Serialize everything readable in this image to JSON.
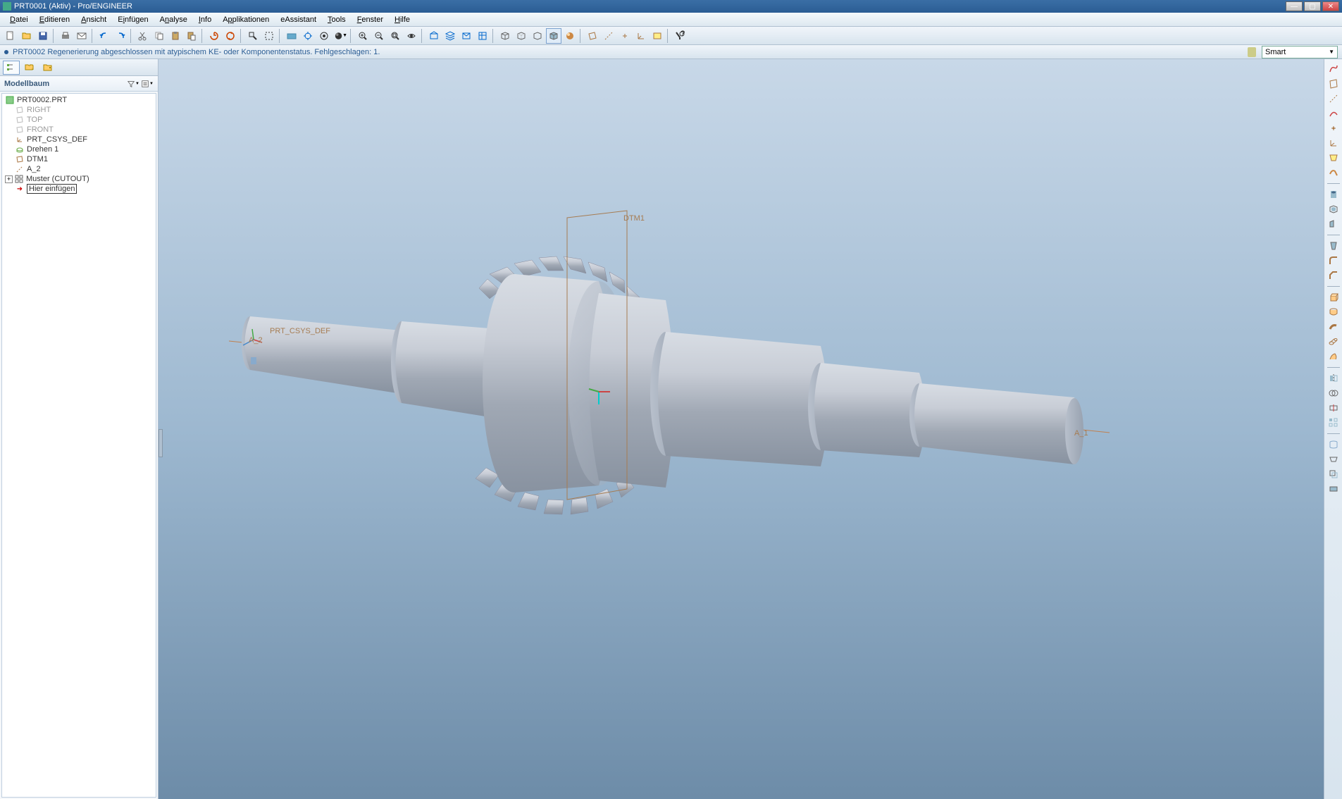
{
  "window": {
    "title": "PRT0001 (Aktiv) - Pro/ENGINEER"
  },
  "menubar": {
    "items": [
      "Datei",
      "Editieren",
      "Ansicht",
      "Einfügen",
      "Analyse",
      "Info",
      "Applikationen",
      "eAssistant",
      "Tools",
      "Fenster",
      "Hilfe"
    ]
  },
  "status": {
    "message": "PRT0002 Regenerierung abgeschlossen mit atypischem KE- oder Komponentenstatus. Fehlgeschlagen: 1.",
    "filter_label": "Smart"
  },
  "panel": {
    "header": "Modellbaum"
  },
  "tree": {
    "root": "PRT0002.PRT",
    "items": [
      {
        "label": "RIGHT",
        "indent": 1,
        "dim": true,
        "icon": "plane"
      },
      {
        "label": "TOP",
        "indent": 1,
        "dim": true,
        "icon": "plane"
      },
      {
        "label": "FRONT",
        "indent": 1,
        "dim": true,
        "icon": "plane"
      },
      {
        "label": "PRT_CSYS_DEF",
        "indent": 1,
        "dim": false,
        "icon": "csys"
      },
      {
        "label": "Drehen 1",
        "indent": 1,
        "dim": false,
        "icon": "revolve"
      },
      {
        "label": "DTM1",
        "indent": 1,
        "dim": false,
        "icon": "plane"
      },
      {
        "label": "A_2",
        "indent": 1,
        "dim": false,
        "icon": "axis"
      },
      {
        "label": "Muster (CUTOUT)",
        "indent": 1,
        "dim": false,
        "icon": "pattern",
        "expandable": true
      },
      {
        "label": "Hier einfügen",
        "indent": 1,
        "dim": false,
        "icon": "insert",
        "boxed": true
      }
    ]
  },
  "viewport": {
    "labels": {
      "dtm1": "DTM1",
      "csys": "PRT_CSYS_DEF",
      "a2": "A_2",
      "a1": "A_1"
    }
  }
}
